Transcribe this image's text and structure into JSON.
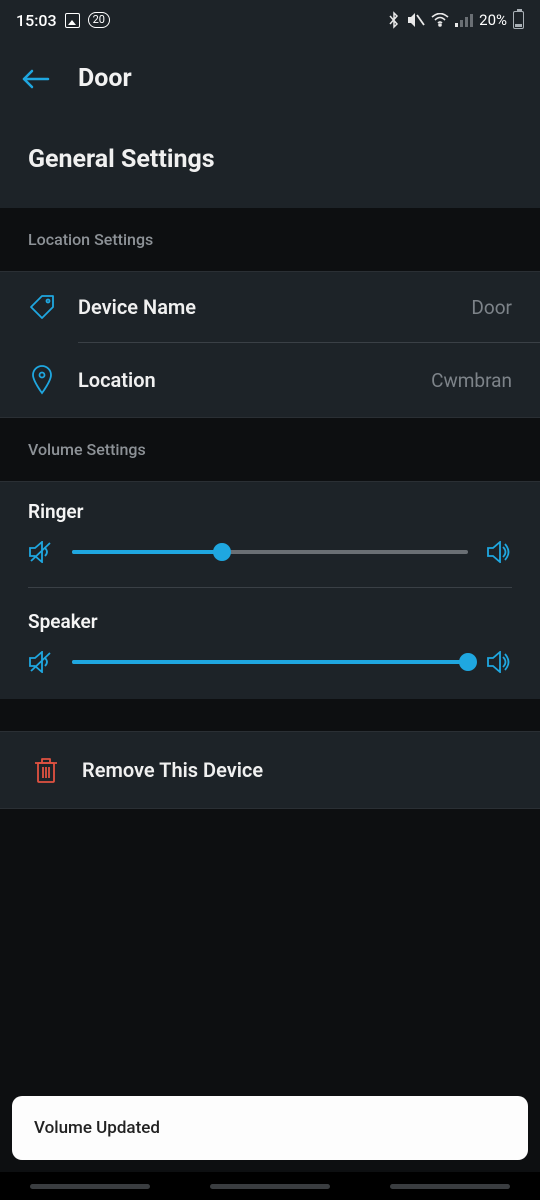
{
  "status": {
    "time": "15:03",
    "badge": "20",
    "battery_pct": "20%"
  },
  "header": {
    "title": "Door"
  },
  "page": {
    "title": "General Settings"
  },
  "sections": {
    "location_header": "Location Settings",
    "volume_header": "Volume Settings"
  },
  "device_name": {
    "label": "Device Name",
    "value": "Door"
  },
  "location": {
    "label": "Location",
    "value": "Cwmbran"
  },
  "volume": {
    "ringer": {
      "label": "Ringer",
      "percent": 38
    },
    "speaker": {
      "label": "Speaker",
      "percent": 100
    }
  },
  "remove": {
    "label": "Remove This Device"
  },
  "toast": {
    "text": "Volume Updated"
  },
  "colors": {
    "accent": "#1fa7e0",
    "danger": "#e15241",
    "panel": "#1d2328",
    "bg": "#0d0f11"
  }
}
